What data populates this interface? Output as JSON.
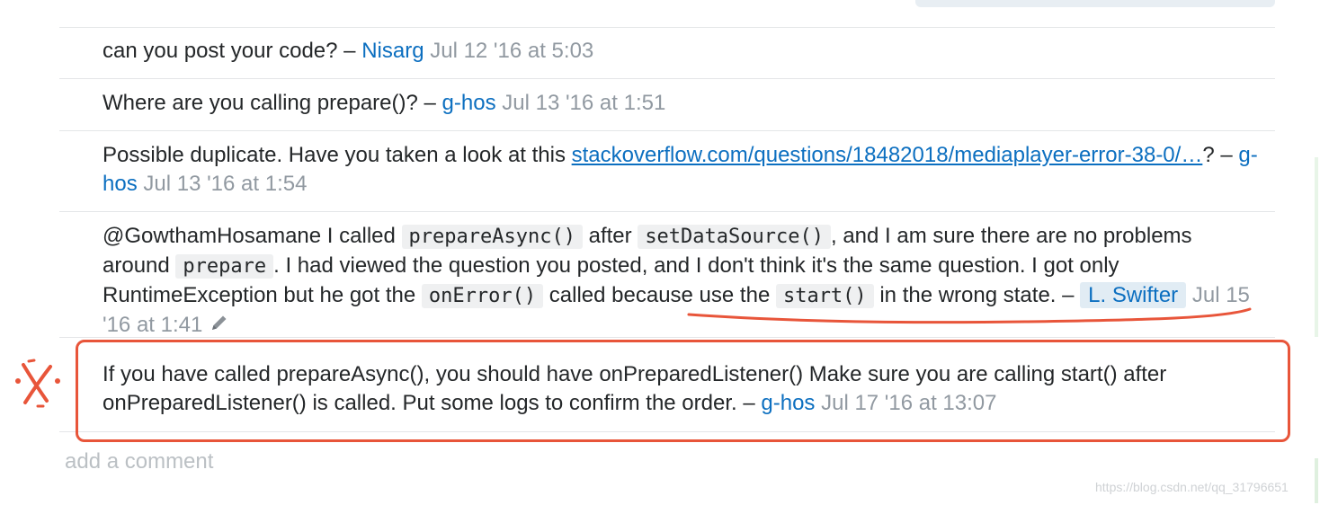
{
  "comments": [
    {
      "text": "can you post your code? – ",
      "user": "Nisarg",
      "date": "Jul 12 '16 at 5:03"
    },
    {
      "text": "Where are you calling prepare()? – ",
      "user": "g-hos",
      "date": "Jul 13 '16 at 1:51"
    },
    {
      "text_before": "Possible duplicate. Have you taken a look at this ",
      "link": "stackoverflow.com/questions/18482018/mediaplayer-error-38-0/…",
      "text_after": "? – ",
      "user": "g-hos",
      "date": "Jul 13 '16 at 1:54"
    },
    {
      "t1": "@GowthamHosamane I called ",
      "c1": "prepareAsync()",
      "t2": " after ",
      "c2": "setDataSource()",
      "t3": ", and I am sure there are no problems around ",
      "c3": "prepare",
      "t4": ". I had viewed the question you posted, and I don't think it's the same question. I got only RuntimeException but he got the ",
      "c4": "onError()",
      "t5": " called because use the ",
      "c5": "start()",
      "t6": " in the wrong state. – ",
      "user": "L. Swifter",
      "date": "Jul 15 '16 at 1:41"
    },
    {
      "text": "If you have called prepareAsync(), you should have onPreparedListener() Make sure you are calling start() after onPreparedListener() is called. Put some logs to confirm the order. – ",
      "user": "g-hos",
      "date": "Jul 17 '16 at 13:07"
    }
  ],
  "add_comment_label": "add a comment",
  "watermark": "https://blog.csdn.net/qq_31796651",
  "annotation_color": "#e8553a"
}
